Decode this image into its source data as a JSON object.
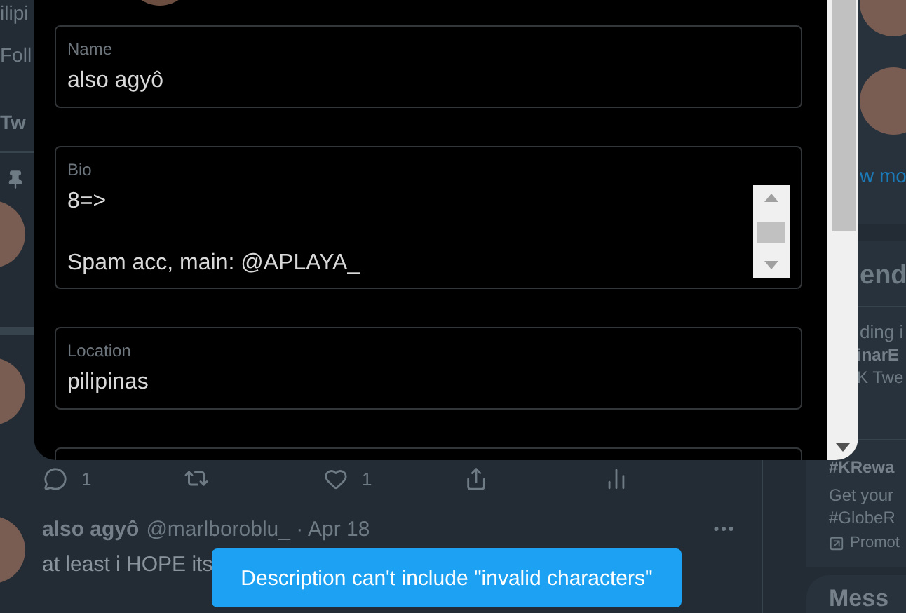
{
  "timeline": {
    "profile_fragments": [
      {
        "kind": "name",
        "text": "ilipi"
      },
      {
        "kind": "meta",
        "text": "Foll"
      },
      {
        "kind": "tab",
        "text": "Tw"
      }
    ],
    "tweet_actions": {
      "reply_count": "1",
      "like_count": "1"
    },
    "tweet": {
      "author": "also agyô",
      "handle_date": "@marlboroblu_ · Apr 18",
      "text": "at least i HOPE its"
    }
  },
  "sidebar": {
    "show_more": "w mo",
    "trends_title": "end",
    "trend": {
      "context": "ding i",
      "name": "inarE",
      "count": "K Twe"
    },
    "promoted": {
      "hashtag": "#KRewa",
      "lines": [
        "Get your",
        "#GlobeR"
      ],
      "label": "Promot"
    },
    "messages_title": "Mess"
  },
  "edit_profile_dialog": {
    "fields": [
      {
        "kind": "input",
        "label": "Name",
        "value": "also agyô"
      },
      {
        "kind": "textarea",
        "label": "Bio",
        "value": "8=>\n\nSpam acc, main: @APLAYA_"
      },
      {
        "kind": "input",
        "label": "Location",
        "value": "pilipinas"
      },
      {
        "kind": "input"
      }
    ]
  },
  "toast": {
    "message": "Description can't include \"invalid characters\""
  }
}
